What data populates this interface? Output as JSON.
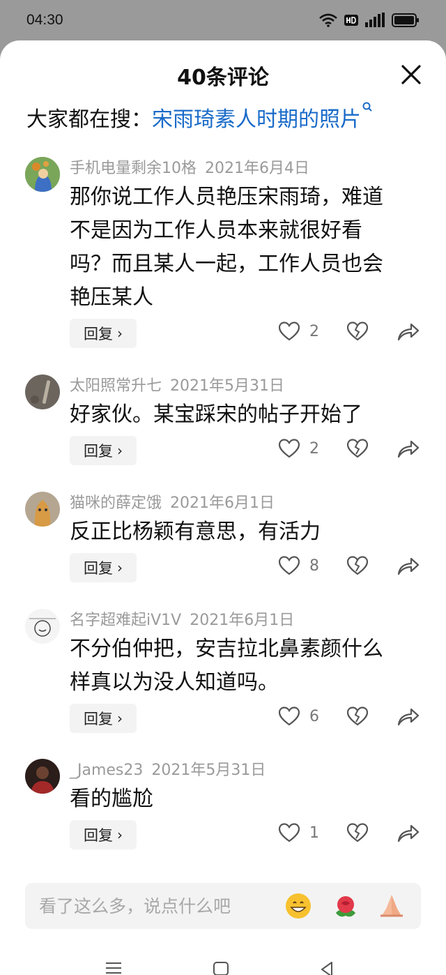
{
  "status": {
    "time": "04:30"
  },
  "header": {
    "title": "40条评论"
  },
  "search": {
    "prefix": "大家都在搜：",
    "query": "宋雨琦素人时期的照片"
  },
  "comments": [
    {
      "user": "手机电量剩余10格",
      "date": "2021年6月4日",
      "lines": [
        "那你说工作人员艳压宋雨琦，难道",
        "不是因为工作人员本来就很好看",
        "吗？而且某人一起，工作人员也会",
        "艳压某人"
      ],
      "reply": "回复",
      "likes": "2"
    },
    {
      "user": "太阳照常升七",
      "date": "2021年5月31日",
      "lines": [
        "好家伙。某宝踩宋的帖子开始了"
      ],
      "reply": "回复",
      "likes": "2"
    },
    {
      "user": "猫咪的薛定饿",
      "date": "2021年6月1日",
      "lines": [
        "反正比杨颖有意思，有活力"
      ],
      "reply": "回复",
      "likes": "8"
    },
    {
      "user": "名字超难起iV1V",
      "date": "2021年6月1日",
      "lines": [
        "不分伯仲把，安吉拉北鼻素颜什么",
        "样真以为没人知道吗。"
      ],
      "reply": "回复",
      "likes": "6"
    },
    {
      "user": "_James23",
      "date": "2021年5月31日",
      "lines": [
        "看的尴尬"
      ],
      "reply": "回复",
      "likes": "1"
    }
  ],
  "input": {
    "placeholder": "看了这么多，说点什么吧"
  },
  "icons": {
    "emojis": [
      "grinning-emoji-icon",
      "rose-emoji-icon",
      "praying-hands-emoji-icon"
    ],
    "nav": [
      "menu-icon",
      "home-icon",
      "back-icon"
    ]
  },
  "colors": {
    "link": "#1a6bc9",
    "meta": "#9a9a9a",
    "text": "#111111"
  }
}
